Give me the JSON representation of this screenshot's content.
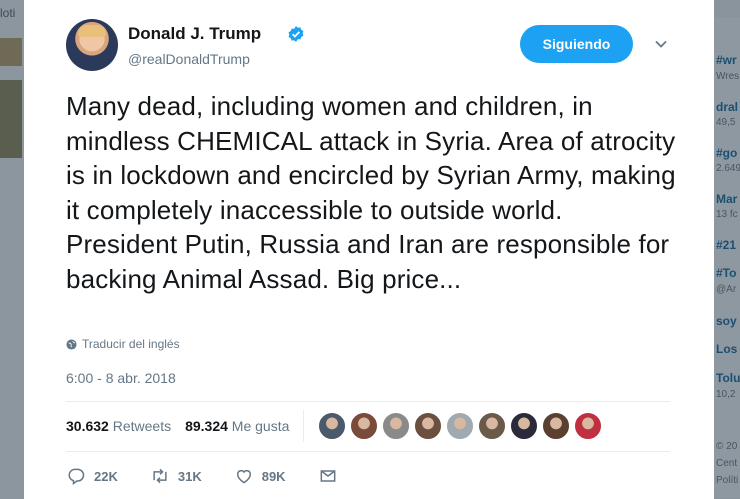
{
  "background": {
    "left_label": "loti",
    "trends": [
      {
        "tag": "#wr",
        "sub": "Wres"
      },
      {
        "tag": "dral",
        "sub": "49,5"
      },
      {
        "tag": "#go",
        "sub": "2.649"
      },
      {
        "tag": "Mar",
        "sub": "13 fc"
      },
      {
        "tag": "#21",
        "sub": ""
      },
      {
        "tag": "#To",
        "sub": "@Ar"
      },
      {
        "tag": "soy",
        "sub": ""
      },
      {
        "tag": "Los",
        "sub": ""
      },
      {
        "tag": "Tolu",
        "sub": "10,2"
      },
      {
        "tag": "",
        "sub": "© 20"
      },
      {
        "tag": "",
        "sub": "Cent"
      },
      {
        "tag": "",
        "sub": "Políti"
      }
    ]
  },
  "tweet": {
    "author_name": "Donald J. Trump",
    "handle": "@realDonaldTrump",
    "follow_button": "Siguiendo",
    "text": "Many dead, including women and children, in mindless CHEMICAL attack in Syria. Area of atrocity is in lockdown and encircled by Syrian Army, making it completely inaccessible to outside world. President Putin, Russia and Iran are responsible for backing Animal Assad. Big price...",
    "translate_label": "Traducir del inglés",
    "timestamp": "6:00 - 8 abr. 2018",
    "retweets_count": "30.632",
    "retweets_label": "Retweets",
    "likes_count": "89.324",
    "likes_label": "Me gusta",
    "liker_colors": [
      "#4a5a6a",
      "#7a4a3a",
      "#8a8a8a",
      "#6b5040",
      "#a0a8b0",
      "#6a5a4a",
      "#2a2a3a",
      "#5a4030",
      "#c03040"
    ],
    "actions": {
      "replies": "22K",
      "retweets": "31K",
      "likes": "89K"
    }
  },
  "colors": {
    "accent": "#1da1f2",
    "text_primary": "#14171a",
    "text_secondary": "#657786"
  },
  "icons": [
    "verified-badge-icon",
    "chevron-down-icon",
    "globe-icon",
    "reply-icon",
    "retweet-icon",
    "heart-icon",
    "direct-message-icon"
  ]
}
